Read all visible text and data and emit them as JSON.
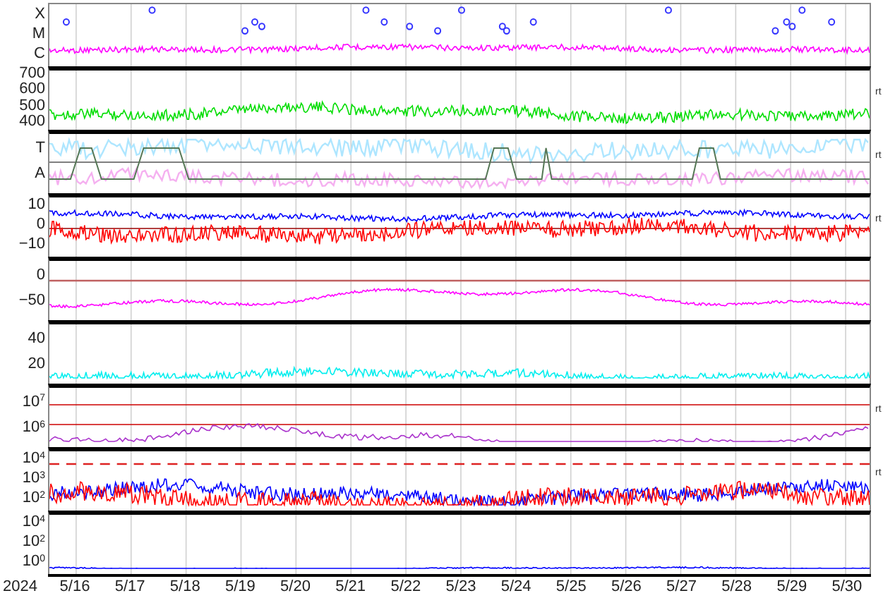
{
  "panels": [
    {
      "kind": "xray",
      "ticks": [
        "X",
        "M",
        "C"
      ]
    },
    {
      "kind": "speed",
      "ticks": [
        "700",
        "600",
        "500",
        "400"
      ],
      "note": "rt"
    },
    {
      "kind": "imf",
      "ticks": [
        "T",
        "A"
      ],
      "note": "rt"
    },
    {
      "kind": "bz",
      "ticks": [
        "10",
        "0",
        "−10"
      ],
      "note": "rt"
    },
    {
      "kind": "dst",
      "ticks": [
        "0",
        "−50"
      ]
    },
    {
      "kind": "ae",
      "ticks": [
        "40",
        "20"
      ]
    },
    {
      "kind": "electron",
      "ticks": [
        "10$^{7}$",
        "10$^{6}$"
      ],
      "note": "rt"
    },
    {
      "kind": "proton",
      "ticks": [
        "10$^{4}$",
        "10$^{3}$",
        "10$^{2}$"
      ],
      "note": "rt"
    },
    {
      "kind": "flux",
      "ticks": [
        "10$^{4}$",
        "10$^{2}$",
        "10$^{0}$"
      ]
    }
  ],
  "axis": {
    "year": "2024",
    "dates": [
      "5/16",
      "5/17",
      "5/18",
      "5/19",
      "5/20",
      "5/21",
      "5/22",
      "5/23",
      "5/24",
      "5/25",
      "5/26",
      "5/27",
      "5/28",
      "5/29",
      "5/30"
    ]
  }
}
